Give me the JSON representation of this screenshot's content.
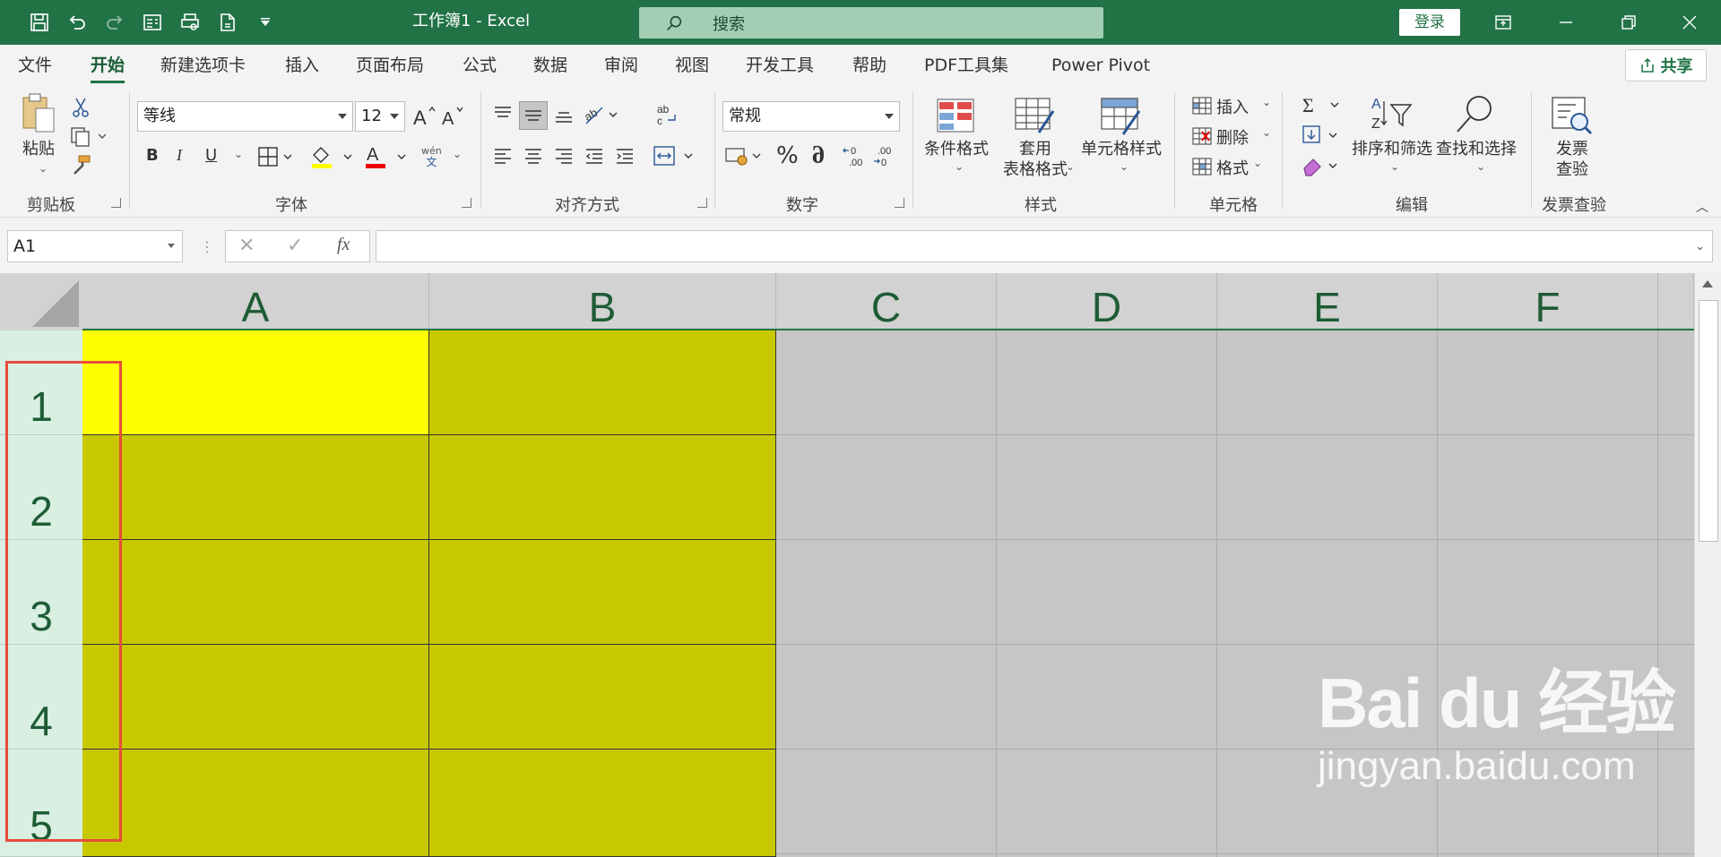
{
  "window": {
    "title": "工作簿1  -  Excel",
    "search_placeholder": "搜索",
    "login_label": "登录"
  },
  "tabs": [
    "文件",
    "开始",
    "新建选项卡",
    "插入",
    "页面布局",
    "公式",
    "数据",
    "审阅",
    "视图",
    "开发工具",
    "帮助",
    "PDF工具集",
    "Power Pivot"
  ],
  "share_label": "共享",
  "ribbon": {
    "clipboard": {
      "paste": "粘贴",
      "group": "剪贴板"
    },
    "font": {
      "name": "等线",
      "size": "12",
      "group": "字体",
      "bold": "B",
      "italic": "I",
      "underline": "U",
      "phonetic_top": "wén",
      "phonetic_bottom": "文"
    },
    "alignment": {
      "group": "对齐方式"
    },
    "number": {
      "format": "常规",
      "percent": "%",
      "comma": "9",
      "group": "数字"
    },
    "styles": {
      "conditional": "条件格式",
      "table_line1": "套用",
      "table_line2": "表格格式",
      "cell_styles": "单元格样式",
      "group": "样式"
    },
    "cells": {
      "insert": "插入",
      "delete": "删除",
      "format": "格式",
      "group": "单元格"
    },
    "editing": {
      "sort": "排序和筛选",
      "find": "查找和选择",
      "group": "编辑"
    },
    "invoice": {
      "line1": "发票",
      "line2": "查验",
      "group": "发票查验"
    }
  },
  "formula": {
    "name_box": "A1",
    "fx": "fx",
    "value": ""
  },
  "columns": [
    "A",
    "B",
    "C",
    "D",
    "E",
    "F"
  ],
  "rows": [
    "1",
    "2",
    "3",
    "4",
    "5"
  ],
  "colors": {
    "brand": "#217346",
    "selected_cell": "#ffff00",
    "fill_cells": "#c8c800",
    "annotation": "#e74c3c"
  },
  "watermark": {
    "logo": "Bai du 经验",
    "url": "jingyan.baidu.com"
  }
}
